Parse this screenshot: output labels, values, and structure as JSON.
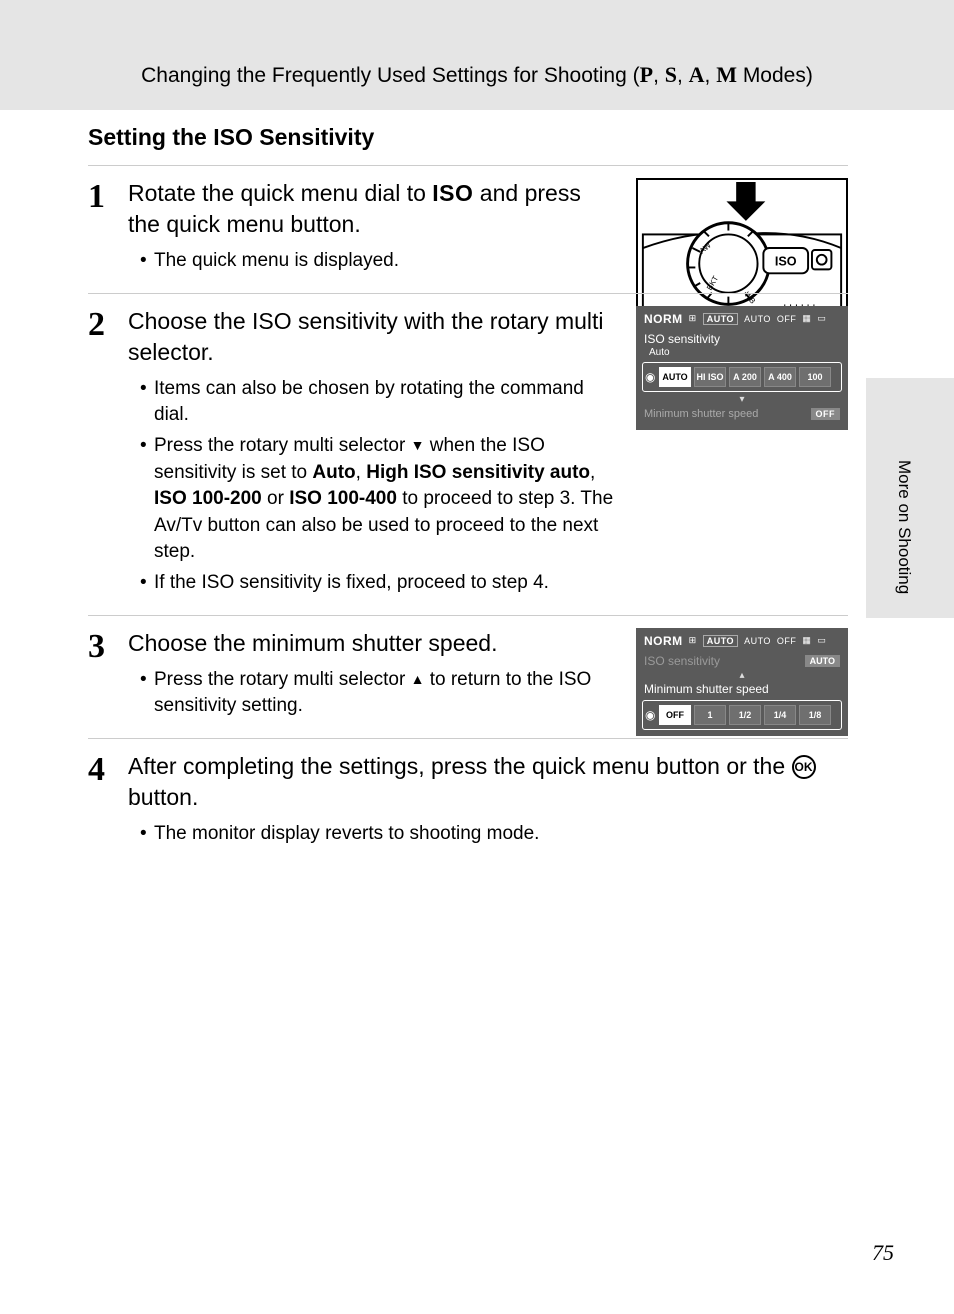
{
  "header": {
    "prefix": "Changing the Frequently Used Settings for Shooting (",
    "modes": [
      "P",
      "S",
      "A",
      "M"
    ],
    "suffix": " Modes)"
  },
  "section_title": "Setting the ISO Sensitivity",
  "steps": {
    "s1": {
      "num": "1",
      "head_a": "Rotate the quick menu dial to ",
      "head_iso": "ISO",
      "head_b": " and press the quick menu button.",
      "bul1": "The quick menu is displayed.",
      "fig": {
        "iso_label": "ISO"
      }
    },
    "s2": {
      "num": "2",
      "head": "Choose the ISO sensitivity with the rotary multi selector.",
      "bul1": "Items can also be chosen by rotating the command dial.",
      "bul2a": "Press the rotary multi selector ",
      "bul2_tri": "▼",
      "bul2b": " when the ISO sensitivity is set to ",
      "bul2_b1": "Auto",
      "bul2_c": ", ",
      "bul2_b2": "High ISO sensitivity auto",
      "bul2_d": ", ",
      "bul2_b3": "ISO 100-200",
      "bul2_e": " or ",
      "bul2_b4": "ISO 100-400",
      "bul2_f": " to proceed to step 3. The Av/Tv button can also be used to proceed to the next step.",
      "bul3": "If the ISO sensitivity is fixed, proceed to step 4.",
      "lcd": {
        "top_norm": "NORM",
        "top_auto_sel": "AUTO",
        "top_auto": "AUTO",
        "top_off": "OFF",
        "label": "ISO sensitivity",
        "sublabel": "Auto",
        "cells": [
          "AUTO",
          "HI ISO",
          "A 200",
          "A 400",
          "100"
        ],
        "min_label": "Minimum shutter speed",
        "min_badge": "OFF"
      }
    },
    "s3": {
      "num": "3",
      "head": "Choose the minimum shutter speed.",
      "bul1a": "Press the rotary multi selector ",
      "bul1_tri": "▲",
      "bul1b": " to return to the ISO sensitivity setting.",
      "lcd": {
        "top_norm": "NORM",
        "top_auto_sel": "AUTO",
        "top_auto": "AUTO",
        "top_off": "OFF",
        "iso_label": "ISO sensitivity",
        "iso_badge": "AUTO",
        "min_label": "Minimum shutter speed",
        "cells": [
          "OFF",
          "1",
          "1/2",
          "1/4",
          "1/8"
        ]
      }
    },
    "s4": {
      "num": "4",
      "head_a": "After completing the settings, press the quick menu button or the ",
      "head_ok": "OK",
      "head_b": " button.",
      "bul1": "The monitor display reverts to shooting mode."
    }
  },
  "side_tab": "More on Shooting",
  "page_number": "75"
}
